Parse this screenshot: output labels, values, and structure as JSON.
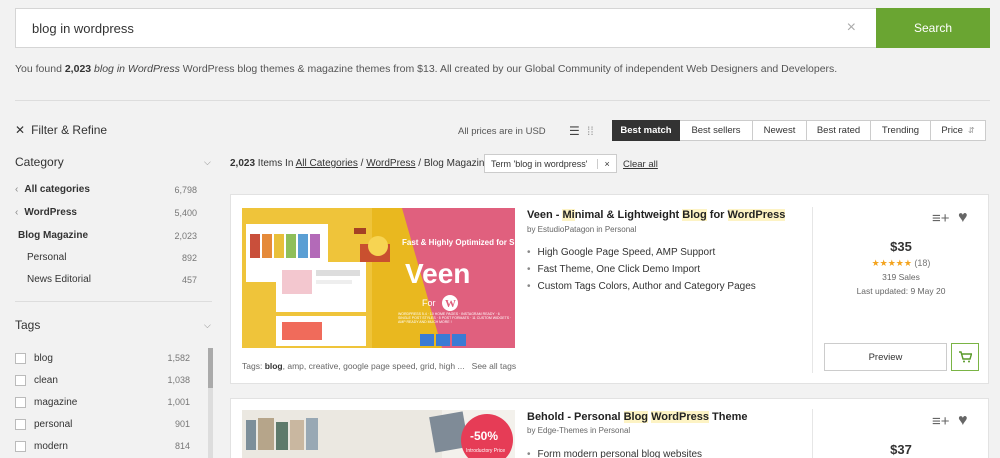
{
  "search": {
    "value": "blog in wordpress",
    "button": "Search",
    "clear": "×"
  },
  "found": {
    "prefix": "You found ",
    "count": "2,023",
    "query": "blog in WordPress",
    "suffix": " WordPress blog themes & magazine themes from $13. All created by our Global Community of independent Web Designers and Developers."
  },
  "filter_refine": "Filter & Refine",
  "toolbar": {
    "prices_note": "All prices are in USD",
    "sort": [
      "Best match",
      "Best sellers",
      "Newest",
      "Best rated",
      "Trending",
      "Price"
    ],
    "active_sort": "Best match"
  },
  "category": {
    "title": "Category",
    "items": [
      {
        "label": "All categories",
        "count": "6,798"
      },
      {
        "label": "WordPress",
        "count": "5,400"
      },
      {
        "label": "Blog Magazine",
        "count": "2,023"
      },
      {
        "label": "Personal",
        "count": "892"
      },
      {
        "label": "News Editorial",
        "count": "457"
      }
    ]
  },
  "tags": {
    "title": "Tags",
    "items": [
      {
        "label": "blog",
        "count": "1,582"
      },
      {
        "label": "clean",
        "count": "1,038"
      },
      {
        "label": "magazine",
        "count": "1,001"
      },
      {
        "label": "personal",
        "count": "901"
      },
      {
        "label": "modern",
        "count": "814"
      }
    ]
  },
  "results_line": {
    "count": "2,023",
    "items_in": " Items In ",
    "crumb_all": "All Categories",
    "sep": " / ",
    "crumb_wp": "WordPress",
    "crumb_blog": "Blog Magazine",
    "term": "Term 'blog in wordpress'",
    "term_x": "×",
    "clear_all": "Clear all"
  },
  "cards": [
    {
      "title_parts": [
        "Veen - ",
        "Mi",
        "nimal & Lightweight ",
        "Blog",
        " for ",
        "WordPress"
      ],
      "author": "by EstudioPatagon in Personal",
      "bullets": [
        "High Google Page Speed, AMP Support",
        "Fast Theme, One Click Demo Import",
        "Custom Tags Colors, Author and Category Pages"
      ],
      "tags_prefix": "Tags: ",
      "tags_bold": "blog",
      "tags_rest": ", amp, creative, google page speed, grid, high ...",
      "see_all": "See all tags",
      "price": "$35",
      "stars": "★★★★★",
      "rating_count": "(18)",
      "sales": "319 Sales",
      "updated": "Last updated: 9 May 20",
      "preview": "Preview",
      "image": {
        "banner": "Fast & Highly Optimized for Speed",
        "name": "Veen",
        "for": "For",
        "fine_print": "WORDPRESS 5.4 · 10 HOME PAGES · INSTAGRAM READY · 6 SINGLE POST STYLES · 5 POST FORMATS · 11 CUSTOM WIDGETS · AMP READY AND MUCH MORE !"
      }
    },
    {
      "title_parts": [
        "Behold - Personal ",
        "Blog",
        " ",
        "WordPress",
        " Theme"
      ],
      "author": "by Edge-Themes in Personal",
      "bullets": [
        "Form modern personal blog websites"
      ],
      "price": "$37",
      "image": {
        "badge": "-50%",
        "badge_sub": "Introductory Price"
      }
    }
  ],
  "colors": {
    "accent_green": "#6aa532",
    "star": "#f3a31e",
    "veen_yellow": "#e9b81f",
    "veen_pink": "#e0607e"
  }
}
